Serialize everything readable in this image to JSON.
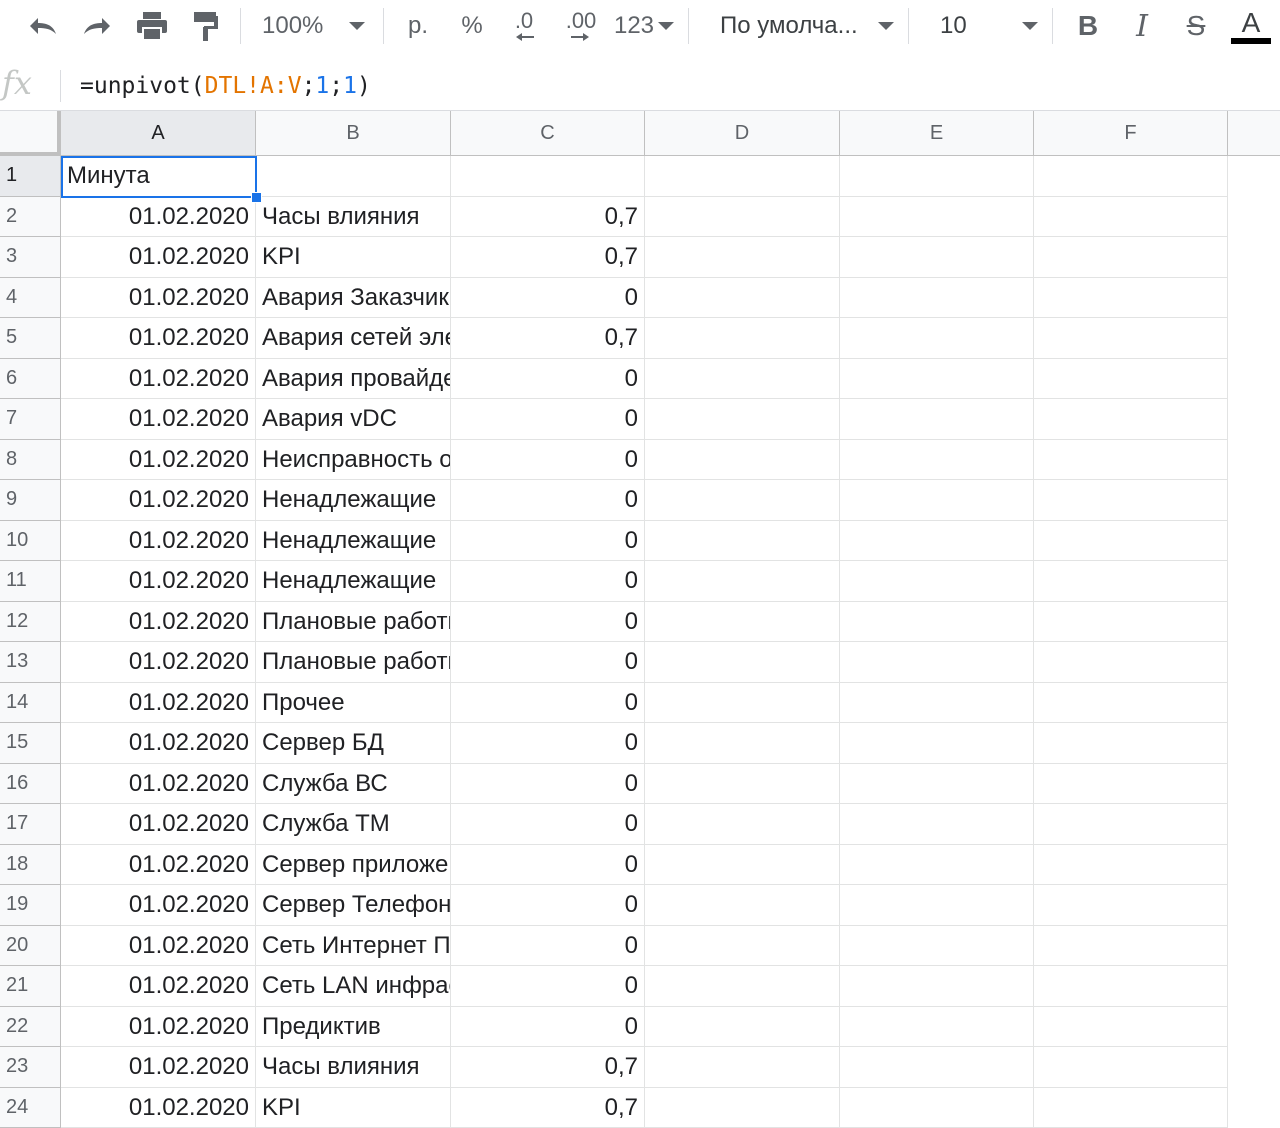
{
  "toolbar": {
    "undo_icon": "undo-icon",
    "redo_icon": "redo-icon",
    "print_icon": "print-icon",
    "paint_format_icon": "paint-format-icon",
    "zoom": "100%",
    "currency": "р.",
    "percent": "%",
    "decrease_decimal": ".0",
    "increase_decimal": ".00",
    "more_formats": "123",
    "font": "По умолча...",
    "font_size": "10",
    "bold": "B",
    "italic": "I",
    "strikethrough": "S",
    "text_color": "A",
    "text_color_value": "#000000"
  },
  "formula_bar": {
    "fx_label": "fx",
    "formula_prefix": "=unpivot(",
    "formula_range": "DTL!A:V",
    "formula_sep1": ";",
    "formula_arg1": "1",
    "formula_sep2": ";",
    "formula_arg2": "1",
    "formula_suffix": ")"
  },
  "grid": {
    "columns": [
      "A",
      "B",
      "C",
      "D",
      "E",
      "F"
    ],
    "active_column": "A",
    "active_cell": "A1",
    "rows": [
      {
        "row": "1",
        "a": "Минута",
        "b": "",
        "c": ""
      },
      {
        "row": "2",
        "a": "01.02.2020",
        "b": "Часы влияния",
        "c": "0,7"
      },
      {
        "row": "3",
        "a": "01.02.2020",
        "b": "KPI",
        "c": "0,7"
      },
      {
        "row": "4",
        "a": "01.02.2020",
        "b": "Авария Заказчика",
        "c": "0"
      },
      {
        "row": "5",
        "a": "01.02.2020",
        "b": "Авария сетей электроснабжения",
        "c": "0,7"
      },
      {
        "row": "6",
        "a": "01.02.2020",
        "b": "Авария провайдера",
        "c": "0"
      },
      {
        "row": "7",
        "a": "01.02.2020",
        "b": "Авария vDC",
        "c": "0"
      },
      {
        "row": "8",
        "a": "01.02.2020",
        "b": "Неисправность оборудования",
        "c": "0"
      },
      {
        "row": "9",
        "a": "01.02.2020",
        "b": "Ненадлежащие",
        "c": "0"
      },
      {
        "row": "10",
        "a": "01.02.2020",
        "b": "Ненадлежащие",
        "c": "0"
      },
      {
        "row": "11",
        "a": "01.02.2020",
        "b": "Ненадлежащие",
        "c": "0"
      },
      {
        "row": "12",
        "a": "01.02.2020",
        "b": "Плановые работы",
        "c": "0"
      },
      {
        "row": "13",
        "a": "01.02.2020",
        "b": "Плановые работы",
        "c": "0"
      },
      {
        "row": "14",
        "a": "01.02.2020",
        "b": "Прочее",
        "c": "0"
      },
      {
        "row": "15",
        "a": "01.02.2020",
        "b": "Сервер БД",
        "c": "0"
      },
      {
        "row": "16",
        "a": "01.02.2020",
        "b": "Служба ВС",
        "c": "0"
      },
      {
        "row": "17",
        "a": "01.02.2020",
        "b": "Служба ТМ",
        "c": "0"
      },
      {
        "row": "18",
        "a": "01.02.2020",
        "b": "Сервер приложений",
        "c": "0"
      },
      {
        "row": "19",
        "a": "01.02.2020",
        "b": "Сервер Телефонии",
        "c": "0"
      },
      {
        "row": "20",
        "a": "01.02.2020",
        "b": "Сеть Интернет Провайдера",
        "c": "0"
      },
      {
        "row": "21",
        "a": "01.02.2020",
        "b": "Сеть LAN инфраструктуры",
        "c": "0"
      },
      {
        "row": "22",
        "a": "01.02.2020",
        "b": "Предиктив",
        "c": "0"
      },
      {
        "row": "23",
        "a": "01.02.2020",
        "b": "Часы влияния",
        "c": "0,7"
      },
      {
        "row": "24",
        "a": "01.02.2020",
        "b": "KPI",
        "c": "0,7"
      }
    ]
  }
}
